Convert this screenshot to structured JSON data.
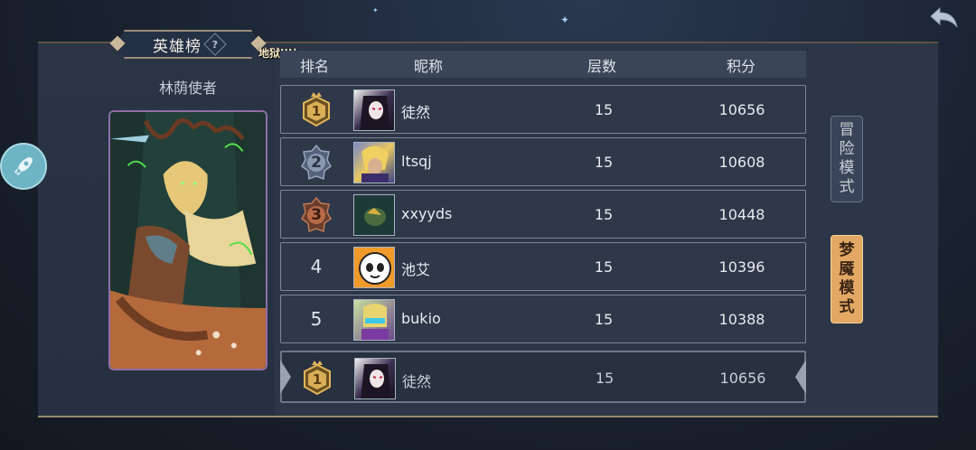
{
  "leaderboard": {
    "title": "英雄榜",
    "help_icon_glyph": "?",
    "difficulty_label": "地狱III！",
    "hero_name": "林荫使者",
    "columns": {
      "rank": "排名",
      "nickname": "昵称",
      "floor": "层数",
      "score": "积分"
    },
    "rows": [
      {
        "rank": "1",
        "badge": "gold",
        "nickname": "徒然",
        "floor": "15",
        "score": "10656"
      },
      {
        "rank": "2",
        "badge": "silver",
        "nickname": "ltsqj",
        "floor": "15",
        "score": "10608"
      },
      {
        "rank": "3",
        "badge": "bronze",
        "nickname": "xxyyds",
        "floor": "15",
        "score": "10448"
      },
      {
        "rank": "4",
        "badge": "none",
        "nickname": "池艾",
        "floor": "15",
        "score": "10396"
      },
      {
        "rank": "5",
        "badge": "none",
        "nickname": "bukio",
        "floor": "15",
        "score": "10388"
      }
    ],
    "self_row": {
      "rank": "1",
      "badge": "gold",
      "nickname": "徒然",
      "floor": "15",
      "score": "10656"
    }
  },
  "modes": {
    "adventure": {
      "chars": [
        "冒",
        "险",
        "模",
        "式"
      ],
      "active": false
    },
    "nightmare": {
      "chars": [
        "梦",
        "魇",
        "模",
        "式"
      ],
      "active": true
    }
  },
  "icons": {
    "back": "back-arrow-icon",
    "side": "rocket-icon"
  },
  "colors": {
    "gold": "#e0b45a",
    "silver": "#8a98b2",
    "bronze": "#b86a48",
    "active_mode": "#e2a864"
  }
}
